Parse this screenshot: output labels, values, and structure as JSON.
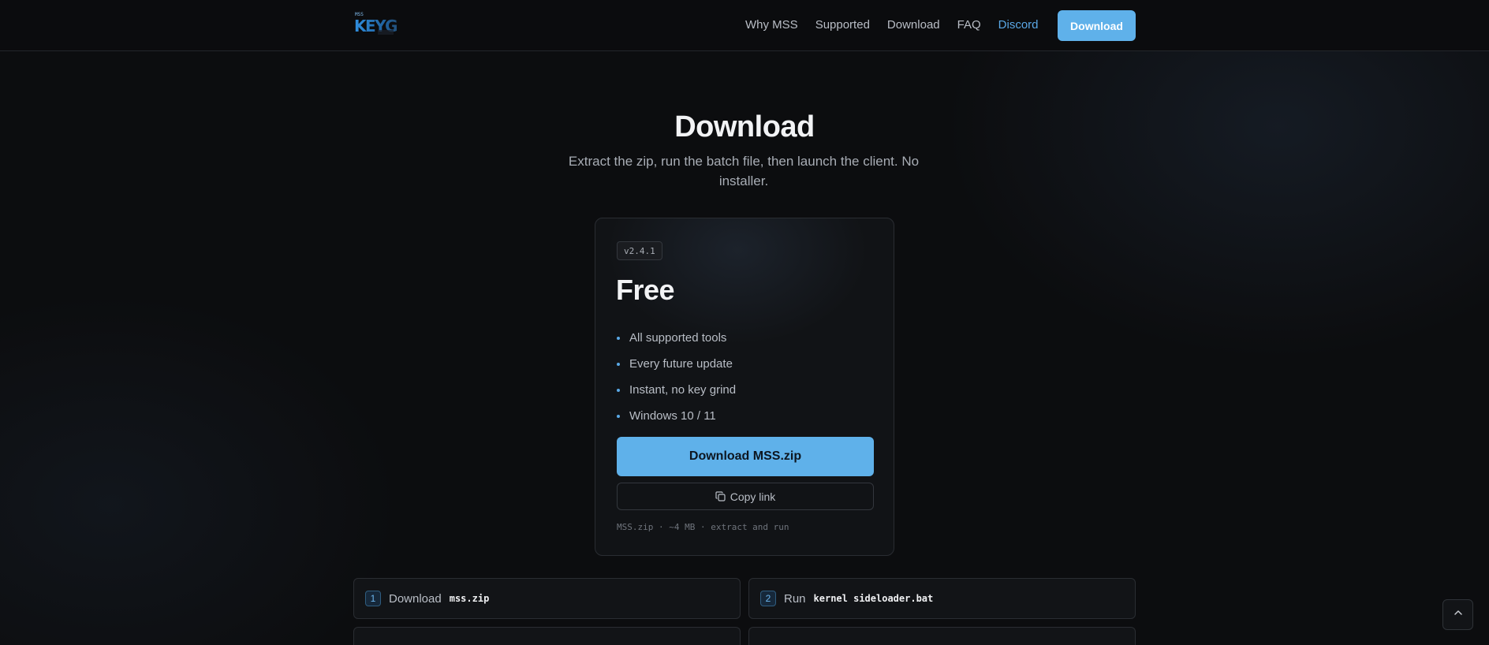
{
  "header": {
    "logo_text": "KEYGEN",
    "logo_small_text": "MSS",
    "nav": {
      "why": "Why MSS",
      "supported": "Supported",
      "download": "Download",
      "faq": "FAQ",
      "discord": "Discord"
    },
    "cta_label": "Download"
  },
  "hero": {
    "title": "Download",
    "subtitle": "Extract the zip, run the batch file, then launch the client. No installer."
  },
  "card": {
    "version": "v2.4.1",
    "plan": "Free",
    "features": [
      "All supported tools",
      "Every future update",
      "Instant, no key grind",
      "Windows 10 / 11"
    ],
    "download_label": "Download MSS.zip",
    "copy_label": "Copy link",
    "meta": "MSS.zip · ~4 MB · extract and run"
  },
  "steps": [
    {
      "num": "1",
      "text": "Download",
      "code": "mss.zip"
    },
    {
      "num": "2",
      "text": "Run",
      "code": "kernel sideloader.bat"
    }
  ],
  "colors": {
    "accent": "#5fb1ea",
    "link": "#5aa8e6",
    "background": "#0c0d0f",
    "card": "#111316"
  },
  "icons": {
    "logo": "keygen-logo-icon",
    "copy": "copy-icon",
    "scroll_top": "chevron-up-icon"
  }
}
